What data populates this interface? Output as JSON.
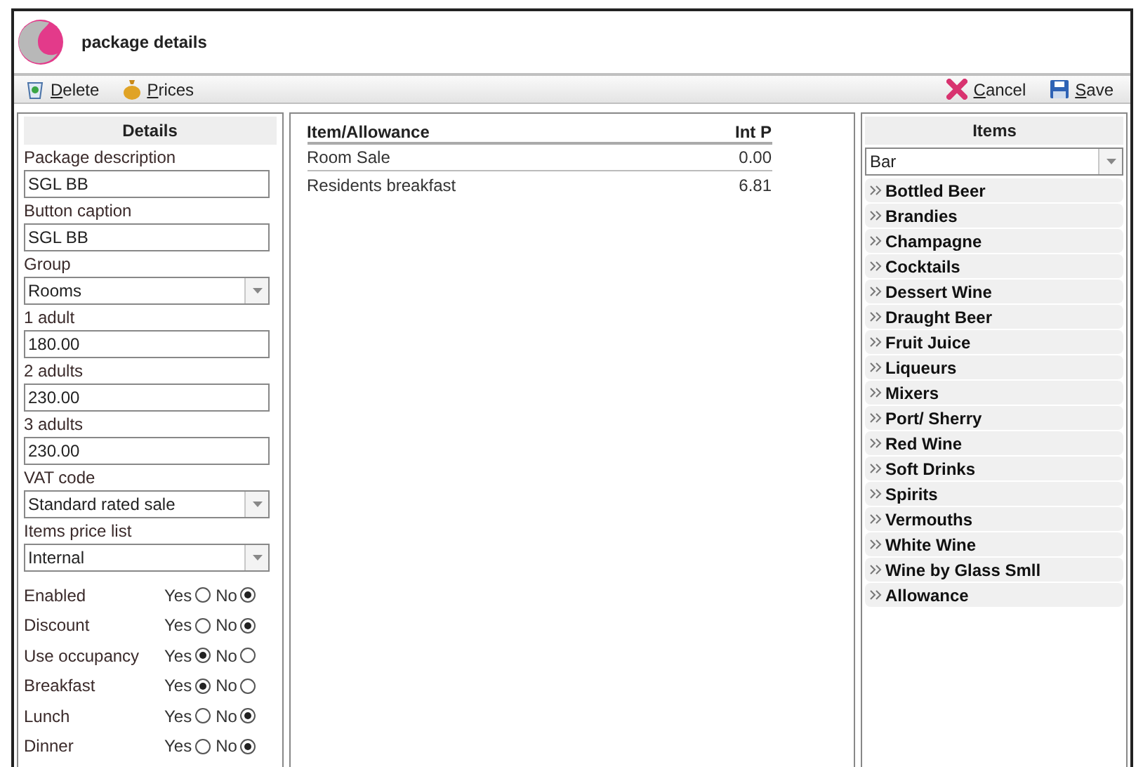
{
  "window": {
    "title": "package details"
  },
  "toolbar": {
    "left": [
      {
        "label": "Delete",
        "kind": "delete"
      },
      {
        "label": "Prices",
        "kind": "prices"
      }
    ],
    "right": [
      {
        "label": "Cancel",
        "kind": "cancel"
      },
      {
        "label": "Save",
        "kind": "save"
      }
    ]
  },
  "details": {
    "title": "Details",
    "fields": [
      {
        "label": "Package description",
        "value": "SGL BB",
        "kind": "text"
      },
      {
        "label": "Button caption",
        "value": "SGL BB",
        "kind": "text"
      },
      {
        "label": "Group",
        "value": "Rooms",
        "kind": "select"
      },
      {
        "label": "1 adult",
        "value": "180.00",
        "kind": "text"
      },
      {
        "label": "2 adults",
        "value": "230.00",
        "kind": "text"
      },
      {
        "label": "3 adults",
        "value": "230.00",
        "kind": "text"
      },
      {
        "label": "VAT code",
        "value": "Standard rated sale",
        "kind": "select"
      },
      {
        "label": "Items price list",
        "value": "Internal",
        "kind": "select"
      }
    ],
    "options": [
      {
        "label": "Enabled",
        "choices": [
          {
            "label": "Yes",
            "selected": false
          },
          {
            "label": "No",
            "selected": true
          }
        ]
      },
      {
        "label": "Discount",
        "choices": [
          {
            "label": "Yes",
            "selected": false
          },
          {
            "label": "No",
            "selected": true
          }
        ]
      },
      {
        "label": "Use occupancy",
        "choices": [
          {
            "label": "Yes",
            "selected": true
          },
          {
            "label": "No",
            "selected": false
          }
        ]
      },
      {
        "label": "Breakfast",
        "choices": [
          {
            "label": "Yes",
            "selected": true
          },
          {
            "label": "No",
            "selected": false
          }
        ]
      },
      {
        "label": "Lunch",
        "choices": [
          {
            "label": "Yes",
            "selected": false
          },
          {
            "label": "No",
            "selected": true
          }
        ]
      },
      {
        "label": "Dinner",
        "choices": [
          {
            "label": "Yes",
            "selected": false
          },
          {
            "label": "No",
            "selected": true
          }
        ]
      }
    ]
  },
  "table": {
    "columns": [
      "Item/Allowance",
      "Int P"
    ],
    "rows": [
      [
        "Room Sale",
        "0.00"
      ],
      [
        "Residents breakfast",
        "6.81"
      ]
    ]
  },
  "items": {
    "title": "Items",
    "filter": "Bar",
    "groups": [
      "Bottled Beer",
      "Brandies",
      "Champagne",
      "Cocktails",
      "Dessert Wine",
      "Draught Beer",
      "Fruit Juice",
      "Liqueurs",
      "Mixers",
      "Port/ Sherry",
      "Red Wine",
      "Soft Drinks",
      "Spirits",
      "Vermouths",
      "White Wine",
      "Wine by Glass Smll",
      "Allowance"
    ]
  }
}
